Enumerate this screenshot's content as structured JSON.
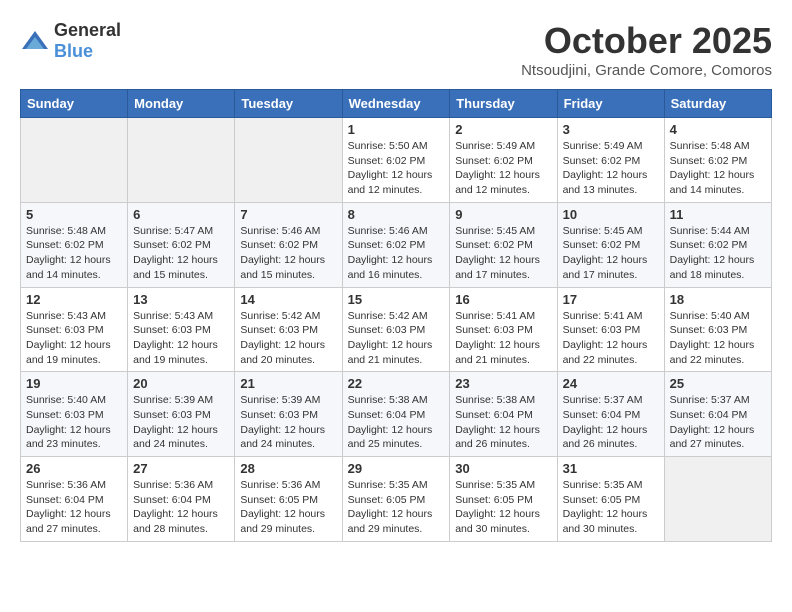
{
  "header": {
    "logo_general": "General",
    "logo_blue": "Blue",
    "month_title": "October 2025",
    "subtitle": "Ntsoudjini, Grande Comore, Comoros"
  },
  "weekdays": [
    "Sunday",
    "Monday",
    "Tuesday",
    "Wednesday",
    "Thursday",
    "Friday",
    "Saturday"
  ],
  "weeks": [
    [
      {
        "day": "",
        "info": ""
      },
      {
        "day": "",
        "info": ""
      },
      {
        "day": "",
        "info": ""
      },
      {
        "day": "1",
        "info": "Sunrise: 5:50 AM\nSunset: 6:02 PM\nDaylight: 12 hours\nand 12 minutes."
      },
      {
        "day": "2",
        "info": "Sunrise: 5:49 AM\nSunset: 6:02 PM\nDaylight: 12 hours\nand 12 minutes."
      },
      {
        "day": "3",
        "info": "Sunrise: 5:49 AM\nSunset: 6:02 PM\nDaylight: 12 hours\nand 13 minutes."
      },
      {
        "day": "4",
        "info": "Sunrise: 5:48 AM\nSunset: 6:02 PM\nDaylight: 12 hours\nand 14 minutes."
      }
    ],
    [
      {
        "day": "5",
        "info": "Sunrise: 5:48 AM\nSunset: 6:02 PM\nDaylight: 12 hours\nand 14 minutes."
      },
      {
        "day": "6",
        "info": "Sunrise: 5:47 AM\nSunset: 6:02 PM\nDaylight: 12 hours\nand 15 minutes."
      },
      {
        "day": "7",
        "info": "Sunrise: 5:46 AM\nSunset: 6:02 PM\nDaylight: 12 hours\nand 15 minutes."
      },
      {
        "day": "8",
        "info": "Sunrise: 5:46 AM\nSunset: 6:02 PM\nDaylight: 12 hours\nand 16 minutes."
      },
      {
        "day": "9",
        "info": "Sunrise: 5:45 AM\nSunset: 6:02 PM\nDaylight: 12 hours\nand 17 minutes."
      },
      {
        "day": "10",
        "info": "Sunrise: 5:45 AM\nSunset: 6:02 PM\nDaylight: 12 hours\nand 17 minutes."
      },
      {
        "day": "11",
        "info": "Sunrise: 5:44 AM\nSunset: 6:02 PM\nDaylight: 12 hours\nand 18 minutes."
      }
    ],
    [
      {
        "day": "12",
        "info": "Sunrise: 5:43 AM\nSunset: 6:03 PM\nDaylight: 12 hours\nand 19 minutes."
      },
      {
        "day": "13",
        "info": "Sunrise: 5:43 AM\nSunset: 6:03 PM\nDaylight: 12 hours\nand 19 minutes."
      },
      {
        "day": "14",
        "info": "Sunrise: 5:42 AM\nSunset: 6:03 PM\nDaylight: 12 hours\nand 20 minutes."
      },
      {
        "day": "15",
        "info": "Sunrise: 5:42 AM\nSunset: 6:03 PM\nDaylight: 12 hours\nand 21 minutes."
      },
      {
        "day": "16",
        "info": "Sunrise: 5:41 AM\nSunset: 6:03 PM\nDaylight: 12 hours\nand 21 minutes."
      },
      {
        "day": "17",
        "info": "Sunrise: 5:41 AM\nSunset: 6:03 PM\nDaylight: 12 hours\nand 22 minutes."
      },
      {
        "day": "18",
        "info": "Sunrise: 5:40 AM\nSunset: 6:03 PM\nDaylight: 12 hours\nand 22 minutes."
      }
    ],
    [
      {
        "day": "19",
        "info": "Sunrise: 5:40 AM\nSunset: 6:03 PM\nDaylight: 12 hours\nand 23 minutes."
      },
      {
        "day": "20",
        "info": "Sunrise: 5:39 AM\nSunset: 6:03 PM\nDaylight: 12 hours\nand 24 minutes."
      },
      {
        "day": "21",
        "info": "Sunrise: 5:39 AM\nSunset: 6:03 PM\nDaylight: 12 hours\nand 24 minutes."
      },
      {
        "day": "22",
        "info": "Sunrise: 5:38 AM\nSunset: 6:04 PM\nDaylight: 12 hours\nand 25 minutes."
      },
      {
        "day": "23",
        "info": "Sunrise: 5:38 AM\nSunset: 6:04 PM\nDaylight: 12 hours\nand 26 minutes."
      },
      {
        "day": "24",
        "info": "Sunrise: 5:37 AM\nSunset: 6:04 PM\nDaylight: 12 hours\nand 26 minutes."
      },
      {
        "day": "25",
        "info": "Sunrise: 5:37 AM\nSunset: 6:04 PM\nDaylight: 12 hours\nand 27 minutes."
      }
    ],
    [
      {
        "day": "26",
        "info": "Sunrise: 5:36 AM\nSunset: 6:04 PM\nDaylight: 12 hours\nand 27 minutes."
      },
      {
        "day": "27",
        "info": "Sunrise: 5:36 AM\nSunset: 6:04 PM\nDaylight: 12 hours\nand 28 minutes."
      },
      {
        "day": "28",
        "info": "Sunrise: 5:36 AM\nSunset: 6:05 PM\nDaylight: 12 hours\nand 29 minutes."
      },
      {
        "day": "29",
        "info": "Sunrise: 5:35 AM\nSunset: 6:05 PM\nDaylight: 12 hours\nand 29 minutes."
      },
      {
        "day": "30",
        "info": "Sunrise: 5:35 AM\nSunset: 6:05 PM\nDaylight: 12 hours\nand 30 minutes."
      },
      {
        "day": "31",
        "info": "Sunrise: 5:35 AM\nSunset: 6:05 PM\nDaylight: 12 hours\nand 30 minutes."
      },
      {
        "day": "",
        "info": ""
      }
    ]
  ]
}
